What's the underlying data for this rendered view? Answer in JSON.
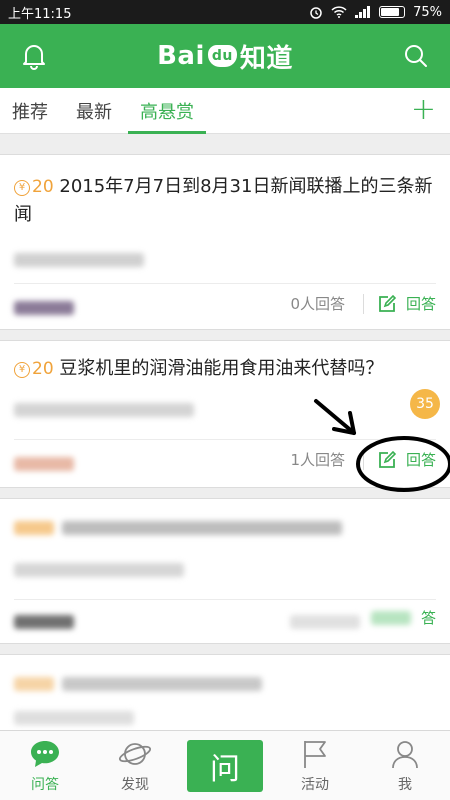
{
  "status_bar": {
    "time": "上午11:15",
    "battery": "75%"
  },
  "header": {
    "logo_prefix": "Bai",
    "logo_paw": "du",
    "logo_suffix": "知道"
  },
  "tabs": [
    {
      "label": "推荐"
    },
    {
      "label": "最新"
    },
    {
      "label": "高悬赏"
    }
  ],
  "tab_add": "+",
  "questions": [
    {
      "reward": "20",
      "title": "2015年7月7日到8月31日新闻联播上的三条新闻",
      "answers": "0人回答",
      "answer_label": "回答"
    },
    {
      "reward": "20",
      "title": "豆浆机里的润滑油能用食用油来代替吗？",
      "answers": "1人回答",
      "answer_label": "回答",
      "badge": "35"
    },
    {
      "reward": "",
      "title": "",
      "answers": "",
      "answer_label": "答"
    },
    {
      "reward": "",
      "title": "",
      "answers": "",
      "answer_label": ""
    }
  ],
  "bottom_nav": {
    "qa": "问答",
    "discover": "发现",
    "ask": "问",
    "activity": "活动",
    "me": "我"
  },
  "coin_symbol": "¥",
  "colors": {
    "brand_green": "#3ab153",
    "reward_orange": "#f0a33b",
    "badge_orange": "#f5b748"
  }
}
